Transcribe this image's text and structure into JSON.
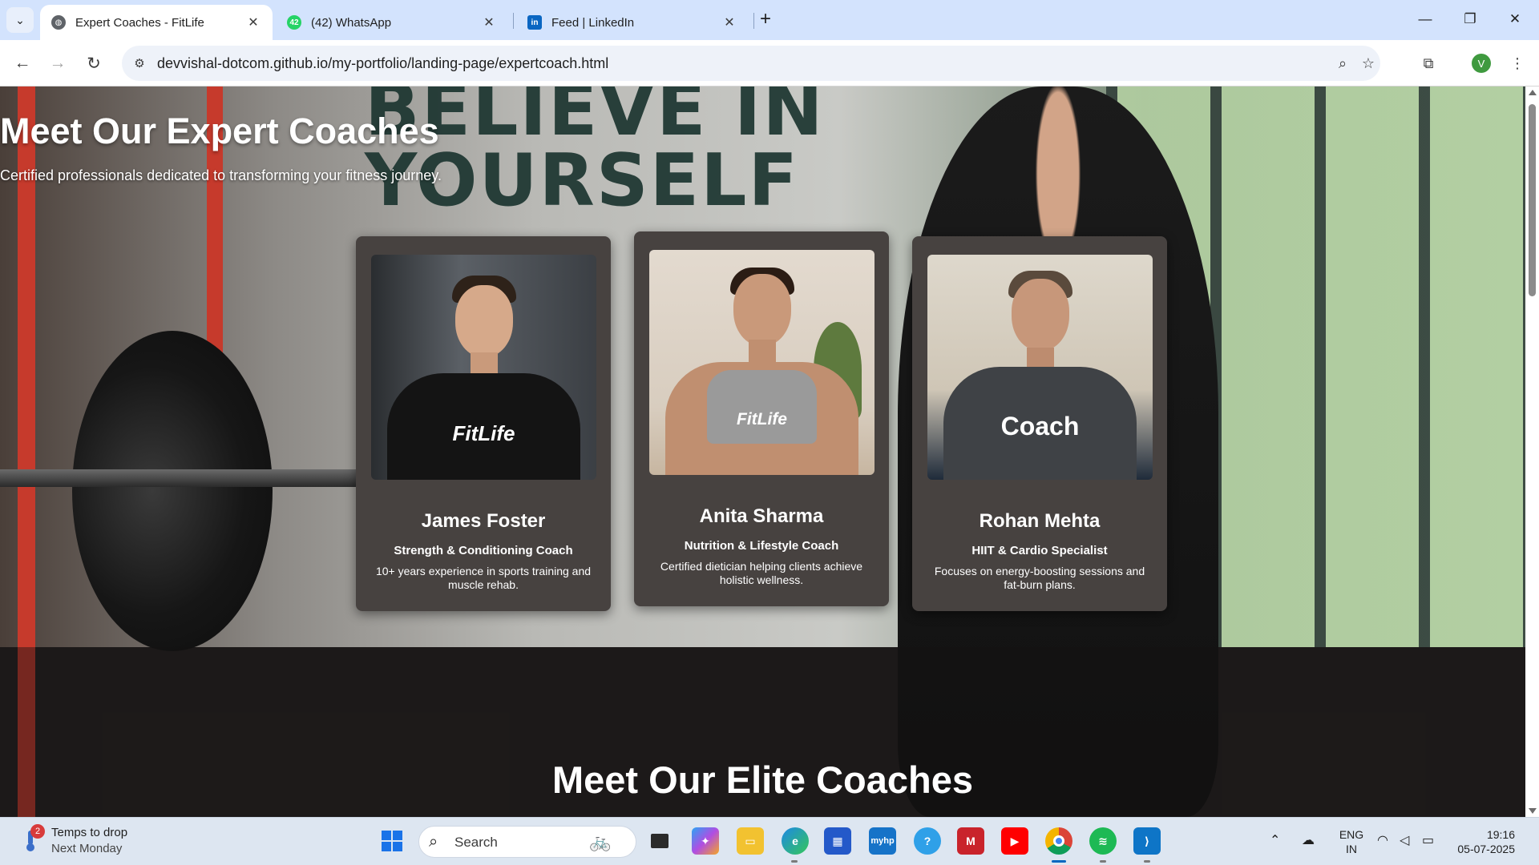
{
  "browser": {
    "tabs": [
      {
        "title": "Expert Coaches - FitLife",
        "active": true,
        "favicon": "globe-icon"
      },
      {
        "title": "(42) WhatsApp",
        "active": false,
        "favicon": "whatsapp-icon",
        "badge": "42"
      },
      {
        "title": "Feed | LinkedIn",
        "active": false,
        "favicon": "linkedin-icon",
        "badge": "in"
      }
    ],
    "url": "devvishal-dotcom.github.io/my-portfolio/landing-page/expertcoach.html",
    "profile_initial": "V"
  },
  "page": {
    "hero_title": "Meet Our Expert Coaches",
    "hero_subtitle": "Certified professionals dedicated to transforming your fitness journey.",
    "background_text": "BELIEVE IN\nYOURSELF",
    "coaches": [
      {
        "name": "James Foster",
        "role": "Strength & Conditioning Coach",
        "description": "10+ years experience in sports training and muscle rehab.",
        "shirt_text": "FitLife"
      },
      {
        "name": "Anita Sharma",
        "role": "Nutrition & Lifestyle Coach",
        "description": "Certified dietician helping clients achieve holistic wellness.",
        "shirt_text": "FitLife"
      },
      {
        "name": "Rohan Mehta",
        "role": "HIIT & Cardio Specialist",
        "description": "Focuses on energy-boosting sessions and fat-burn plans.",
        "shirt_text": "Coach"
      }
    ],
    "section_title": "Meet Our Elite Coaches"
  },
  "taskbar": {
    "weather_badge": "2",
    "weather_line1": "Temps to drop",
    "weather_line2": "Next Monday",
    "search_placeholder": "Search",
    "myhp_label": "myhp",
    "lang_line1": "ENG",
    "lang_line2": "IN",
    "time": "19:16",
    "date": "05-07-2025"
  },
  "colors": {
    "card_bg": "#474240",
    "tabstrip_bg": "#d3e3fd",
    "accent": "#0067c0"
  }
}
